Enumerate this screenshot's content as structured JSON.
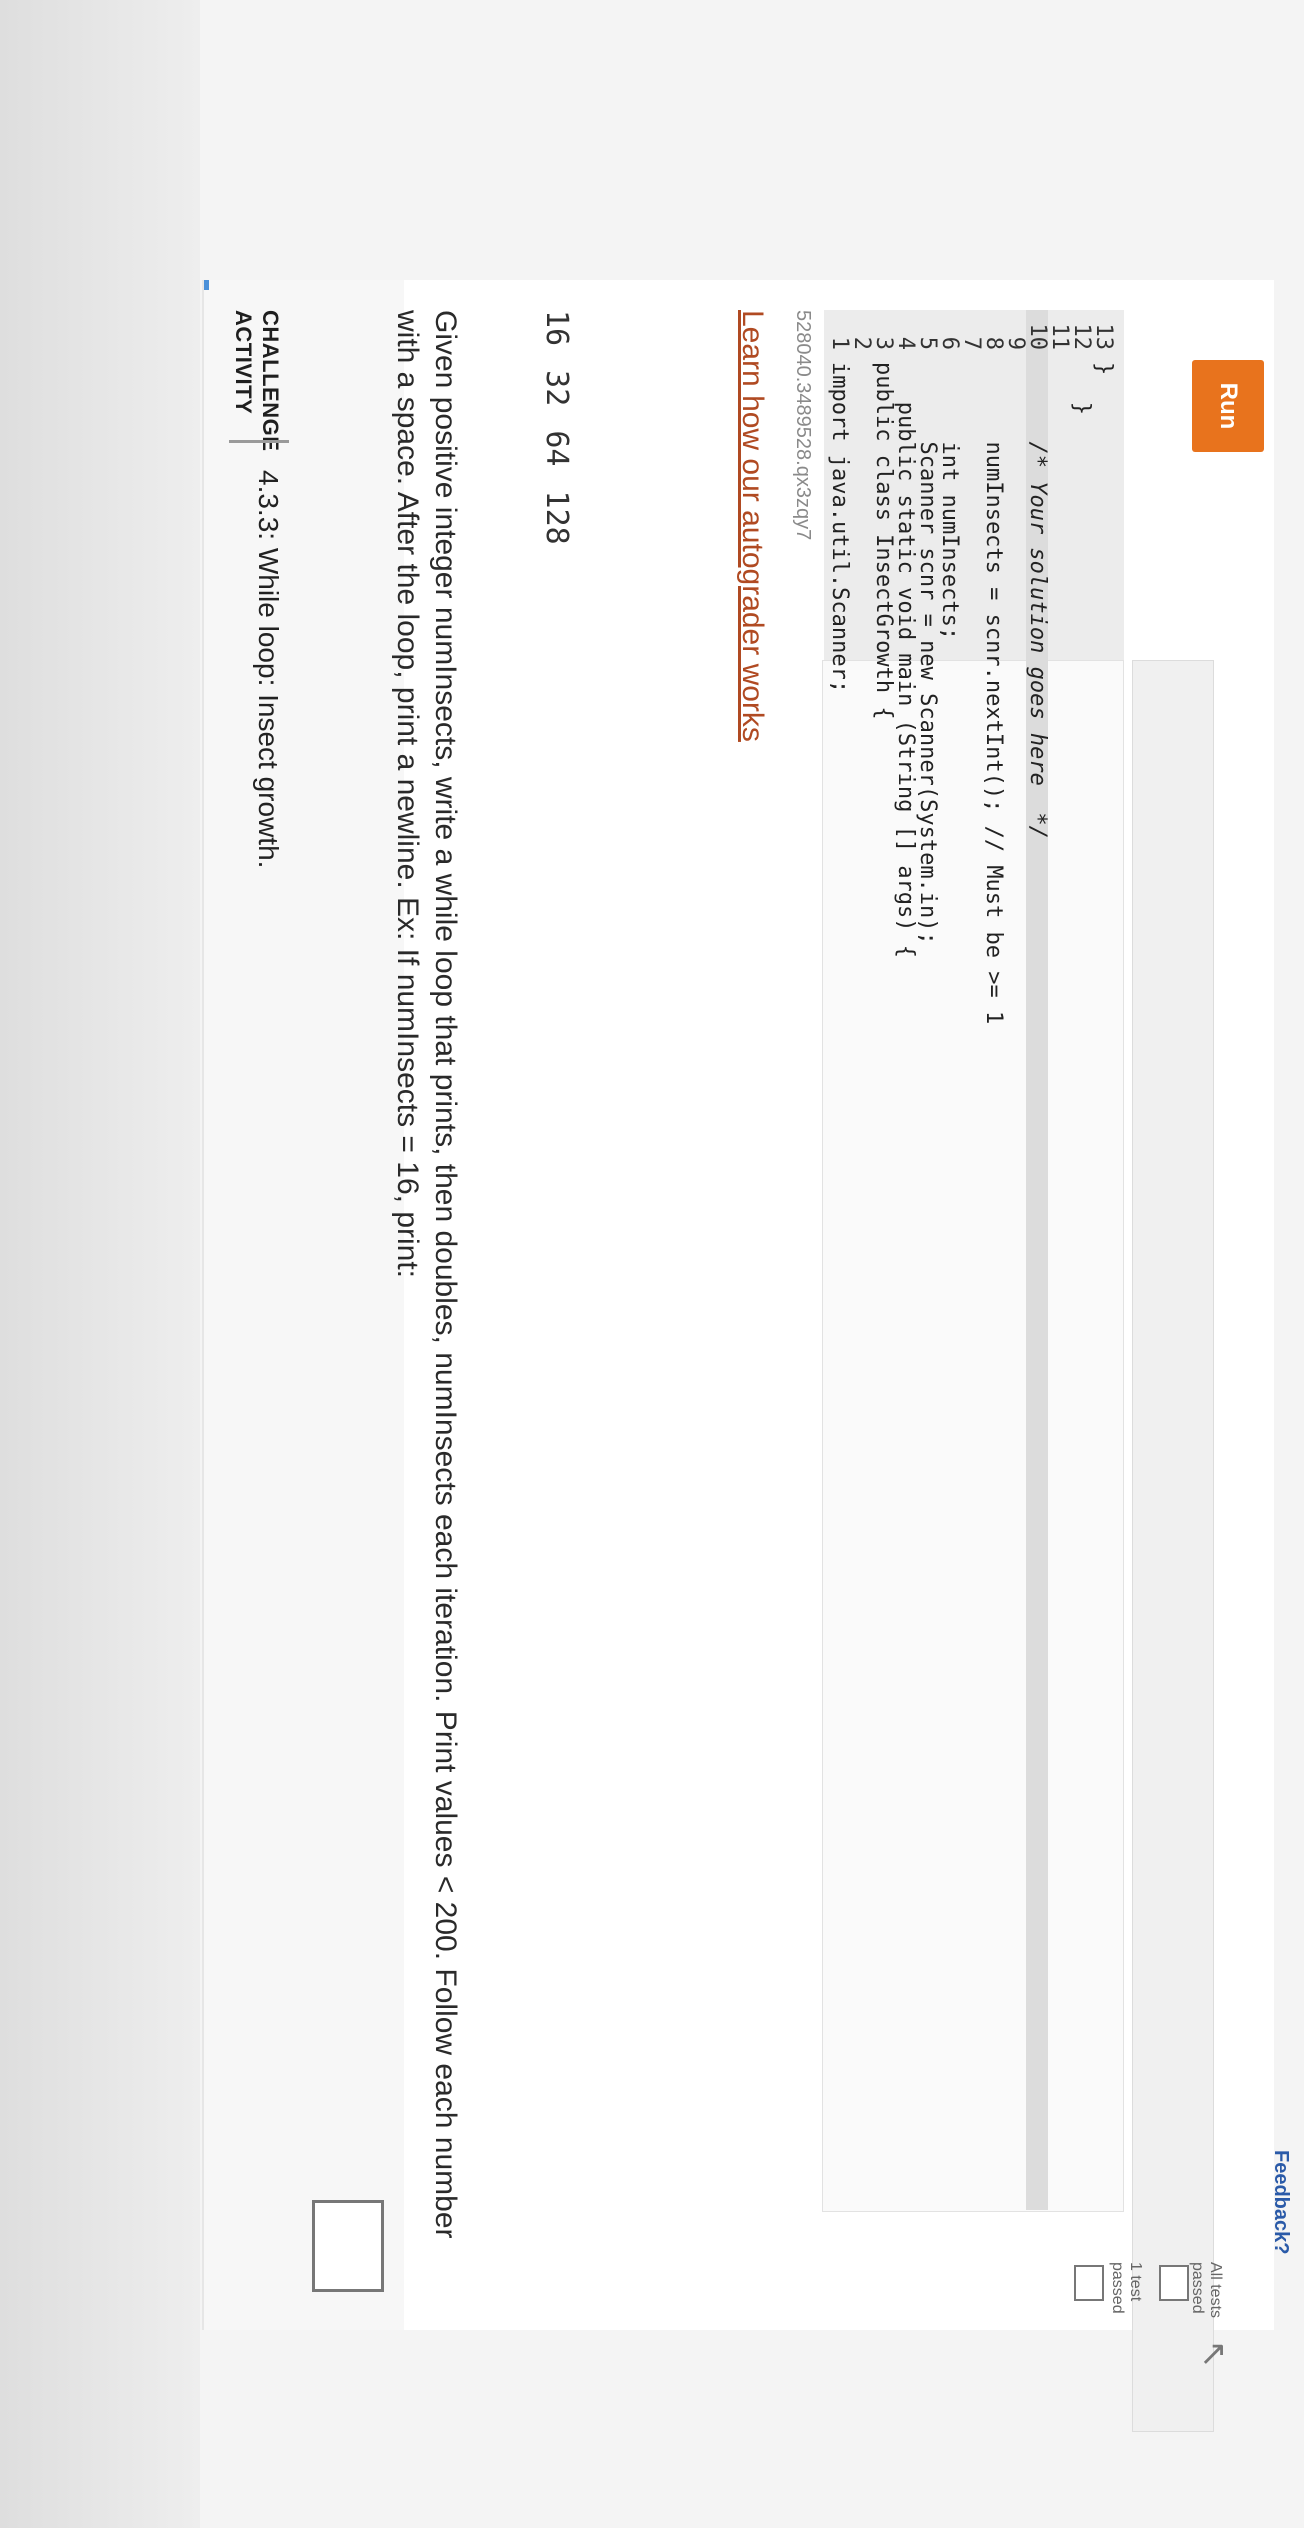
{
  "activity": {
    "label": "CHALLENGE ACTIVITY",
    "title": "4.3.3: While loop: Insect growth."
  },
  "prompt": "Given positive integer numInsects, write a while loop that prints, then doubles, numInsects each iteration. Print values < 200. Follow each number with a space. After the loop, print a newline. Ex: If numInsects = 16, print:",
  "example_output": "16 32 64 128",
  "learn_link": "Learn how our autograder works",
  "activity_code": "528040.3489528.qx3zqy7",
  "code": [
    {
      "n": "1",
      "text": "import java.util.Scanner;"
    },
    {
      "n": "2",
      "text": ""
    },
    {
      "n": "3",
      "text": "public class InsectGrowth {"
    },
    {
      "n": "4",
      "text": "   public static void main (String [] args) {"
    },
    {
      "n": "5",
      "text": "      Scanner scnr = new Scanner(System.in);"
    },
    {
      "n": "6",
      "text": "      int numInsects;"
    },
    {
      "n": "7",
      "text": ""
    },
    {
      "n": "8",
      "text": "      numInsects = scnr.nextInt(); // Must be >= 1"
    },
    {
      "n": "9",
      "text": ""
    },
    {
      "n": "10",
      "text": "      /* Your solution goes here  */"
    },
    {
      "n": "11",
      "text": ""
    },
    {
      "n": "12",
      "text": "   }"
    },
    {
      "n": "13",
      "text": "}"
    }
  ],
  "run_label": "Run",
  "tests": [
    {
      "label": "1 test passed"
    },
    {
      "label": "All tests passed"
    }
  ],
  "feedback_label": "Feedback?",
  "colors": {
    "run_button": "#e8731d",
    "link": "#b04a22",
    "feedback": "#2a5aa8"
  }
}
